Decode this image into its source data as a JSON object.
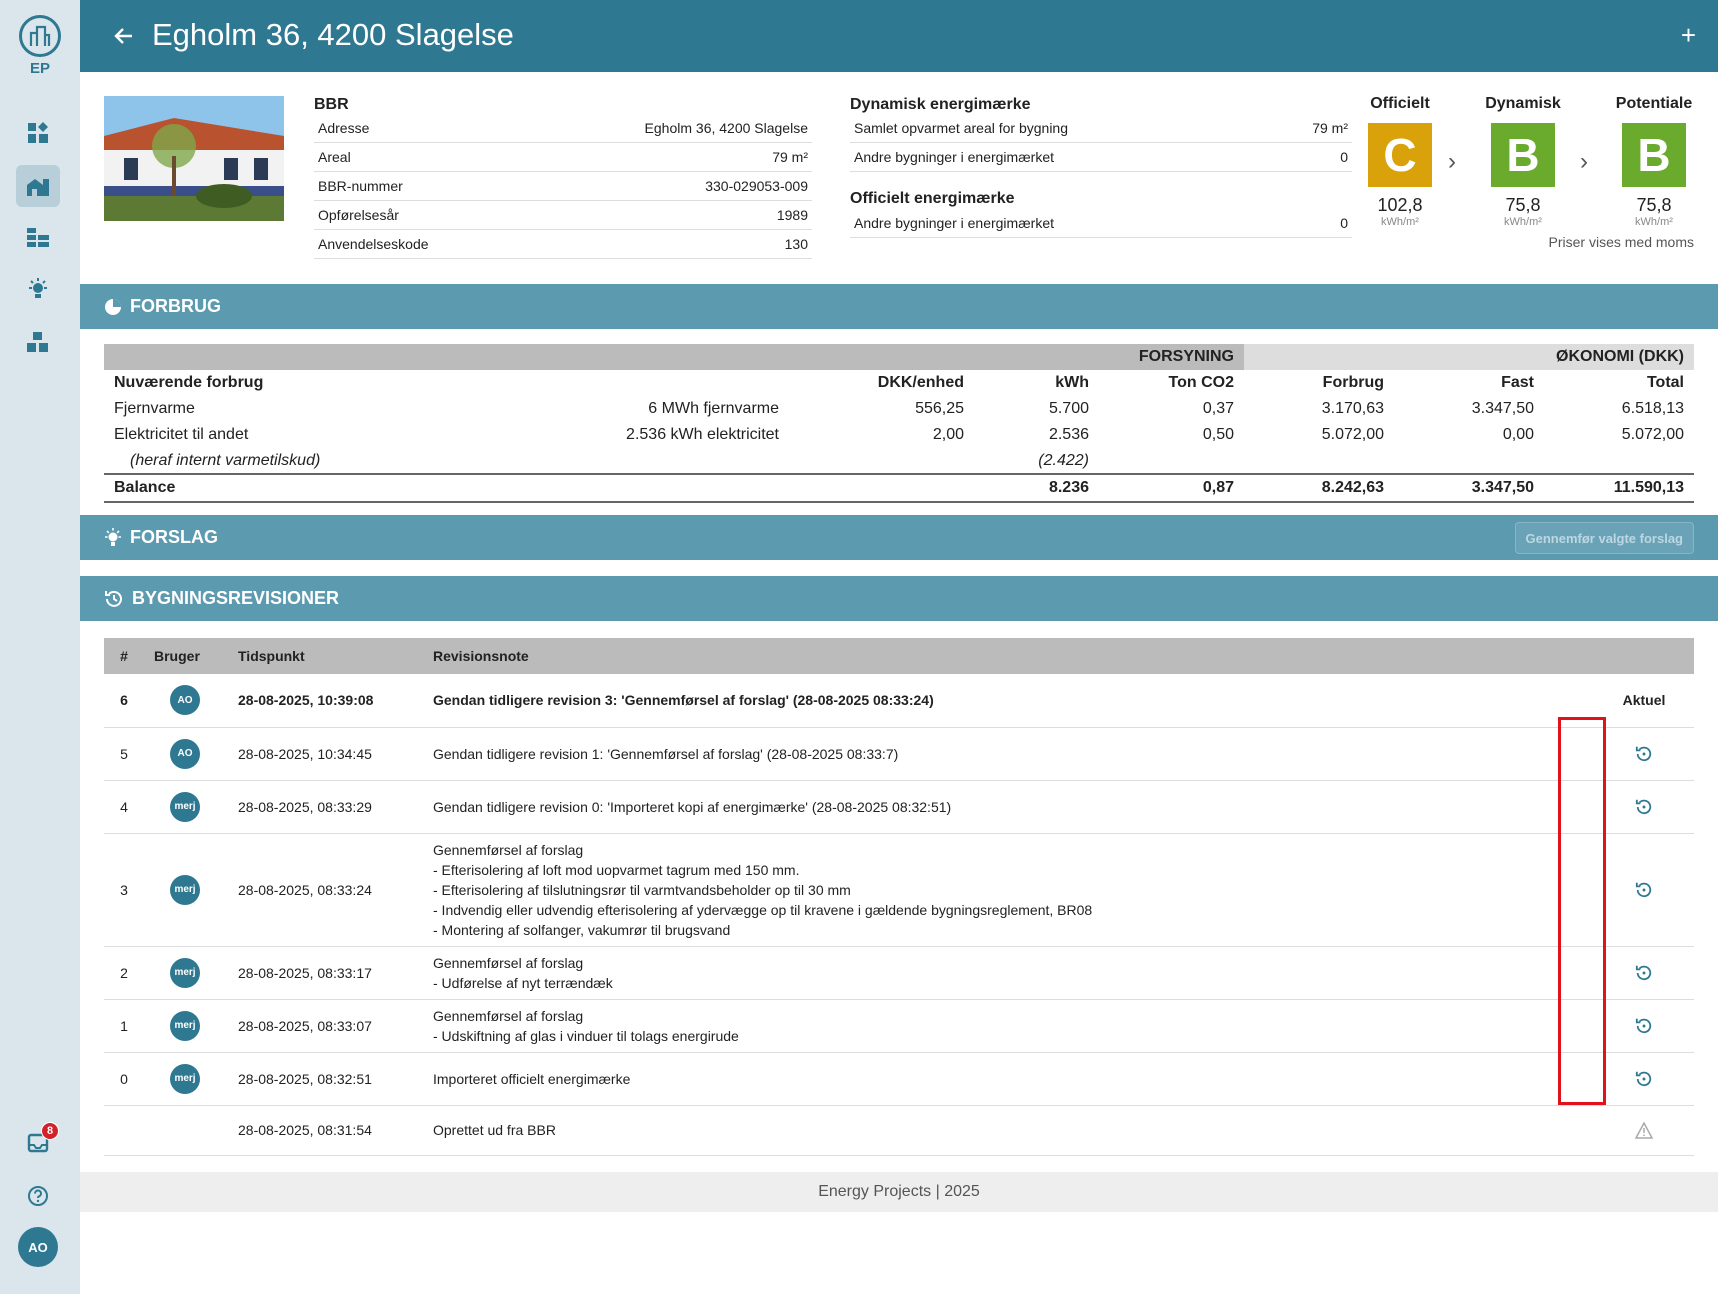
{
  "app": {
    "logo_text": "EP",
    "badge_count": "8",
    "user_initials": "AO"
  },
  "header": {
    "title": "Egholm 36, 4200 Slagelse"
  },
  "bbr": {
    "title": "BBR",
    "rows": [
      {
        "label": "Adresse",
        "value": "Egholm 36, 4200 Slagelse"
      },
      {
        "label": "Areal",
        "value": "79 m²"
      },
      {
        "label": "BBR-nummer",
        "value": "330-029053-009"
      },
      {
        "label": "Opførelsesår",
        "value": "1989"
      },
      {
        "label": "Anvendelseskode",
        "value": "130"
      }
    ]
  },
  "dynamic": {
    "title": "Dynamisk energimærke",
    "rows": [
      {
        "label": "Samlet opvarmet areal for bygning",
        "value": "79 m²"
      },
      {
        "label": "Andre bygninger i energimærket",
        "value": "0"
      }
    ]
  },
  "official": {
    "title": "Officielt energimærke",
    "rows": [
      {
        "label": "Andre bygninger i energimærket",
        "value": "0"
      }
    ]
  },
  "labels": [
    {
      "head": "Officielt",
      "grade": "C",
      "value": "102,8",
      "unit": "kWh/m²",
      "color": "#d9a20b"
    },
    {
      "head": "Dynamisk",
      "grade": "B",
      "value": "75,8",
      "unit": "kWh/m²",
      "color": "#6aaa2c"
    },
    {
      "head": "Potentiale",
      "grade": "B",
      "value": "75,8",
      "unit": "kWh/m²",
      "color": "#6aaa2c"
    }
  ],
  "vat_note": "Priser vises med moms",
  "forbrug": {
    "section_title": "FORBRUG",
    "band_forsyning": "FORSYNING",
    "band_okonomi": "ØKONOMI (DKK)",
    "headers": [
      "Nuværende forbrug",
      "",
      "DKK/enhed",
      "kWh",
      "Ton CO2",
      "Forbrug",
      "Fast",
      "Total"
    ],
    "rows": [
      [
        "Fjernvarme",
        "6 MWh fjernvarme",
        "556,25",
        "5.700",
        "0,37",
        "3.170,63",
        "3.347,50",
        "6.518,13"
      ],
      [
        "Elektricitet til andet",
        "2.536 kWh elektricitet",
        "2,00",
        "2.536",
        "0,50",
        "5.072,00",
        "0,00",
        "5.072,00"
      ]
    ],
    "internal_label": "(heraf internt varmetilskud)",
    "internal_kwh": "(2.422)",
    "balance": [
      "Balance",
      "8.236",
      "0,87",
      "8.242,63",
      "3.347,50",
      "11.590,13"
    ]
  },
  "forslag": {
    "section_title": "FORSLAG",
    "apply_button": "Gennemfør valgte forslag"
  },
  "revisions": {
    "section_title": "BYGNINGSREVISIONER",
    "headers": [
      "#",
      "Bruger",
      "Tidspunkt",
      "Revisionsnote",
      ""
    ],
    "current_label": "Aktuel",
    "rows": [
      {
        "num": "6",
        "user": "AO",
        "time": "28-08-2025, 10:39:08",
        "note": [
          "Gendan tidligere revision 3: 'Gennemførsel af forslag' (28-08-2025 08:33:24)"
        ]
      },
      {
        "num": "5",
        "user": "AO",
        "time": "28-08-2025, 10:34:45",
        "note": [
          "Gendan tidligere revision 1: 'Gennemførsel af forslag' (28-08-2025 08:33:7)"
        ]
      },
      {
        "num": "4",
        "user": "merj",
        "time": "28-08-2025, 08:33:29",
        "note": [
          "Gendan tidligere revision 0: 'Importeret kopi af energimærke' (28-08-2025 08:32:51)"
        ]
      },
      {
        "num": "3",
        "user": "merj",
        "time": "28-08-2025, 08:33:24",
        "note": [
          "Gennemførsel af forslag",
          " - Efterisolering af loft mod uopvarmet tagrum med 150 mm.",
          " - Efterisolering af tilslutningsrør til varmtvandsbeholder op til 30 mm",
          " - Indvendig eller udvendig efterisolering af ydervægge op til kravene i gældende bygningsreglement, BR08",
          " - Montering af solfanger, vakumrør til brugsvand"
        ]
      },
      {
        "num": "2",
        "user": "merj",
        "time": "28-08-2025, 08:33:17",
        "note": [
          "Gennemførsel af forslag",
          " - Udførelse af nyt terrændæk"
        ]
      },
      {
        "num": "1",
        "user": "merj",
        "time": "28-08-2025, 08:33:07",
        "note": [
          "Gennemførsel af forslag",
          " - Udskiftning af glas i vinduer til tolags energirude"
        ]
      },
      {
        "num": "0",
        "user": "merj",
        "time": "28-08-2025, 08:32:51",
        "note": [
          "Importeret officielt energimærke"
        ]
      },
      {
        "num": "",
        "user": "",
        "time": "28-08-2025, 08:31:54",
        "note": [
          "Oprettet ud fra BBR"
        ]
      }
    ]
  },
  "footer": {
    "text": "Energy Projects | 2025"
  }
}
